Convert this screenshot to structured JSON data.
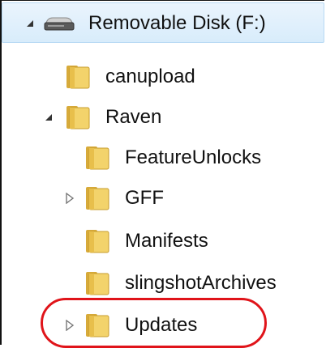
{
  "tree": {
    "items": [
      {
        "label": "Removable Disk (F:)",
        "expander": "expanded",
        "icon": "removable-drive-icon"
      },
      {
        "label": "canupload",
        "expander": "none",
        "icon": "folder-icon"
      },
      {
        "label": "Raven",
        "expander": "expanded",
        "icon": "folder-icon"
      },
      {
        "label": "FeatureUnlocks",
        "expander": "none",
        "icon": "folder-icon"
      },
      {
        "label": "GFF",
        "expander": "collapsed",
        "icon": "folder-icon"
      },
      {
        "label": "Manifests",
        "expander": "none",
        "icon": "folder-icon"
      },
      {
        "label": "slingshotArchives",
        "expander": "none",
        "icon": "folder-icon"
      },
      {
        "label": "Updates",
        "expander": "collapsed",
        "icon": "folder-icon"
      }
    ]
  },
  "colors": {
    "highlight": "#e0141a",
    "folder": "#e9c34f",
    "selection": "#d8ecfb"
  }
}
